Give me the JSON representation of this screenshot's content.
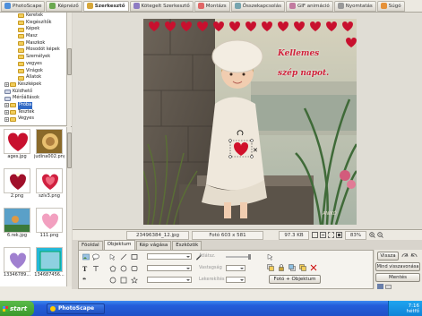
{
  "tabs": [
    {
      "label": "PhotoScape",
      "color": "#4d8fdb"
    },
    {
      "label": "Képnéző",
      "color": "#6aa84f"
    },
    {
      "label": "Szerkesztő",
      "color": "#d7a73a"
    },
    {
      "label": "Kötegelt Szerkesztő",
      "color": "#8e7cc3"
    },
    {
      "label": "Montázs",
      "color": "#e06666"
    },
    {
      "label": "Összekapcsolás",
      "color": "#76a5af"
    },
    {
      "label": "GIF animáció",
      "color": "#c27ba0"
    },
    {
      "label": "Nyomtatás",
      "color": "#999999"
    },
    {
      "label": "Súgó",
      "color": "#e69138"
    }
  ],
  "tree": {
    "items": [
      {
        "label": "Keretek",
        "indent": 2
      },
      {
        "label": "Kiegészítők",
        "indent": 2
      },
      {
        "label": "Képek",
        "indent": 2
      },
      {
        "label": "Masz",
        "indent": 2
      },
      {
        "label": "Maszkok",
        "indent": 2
      },
      {
        "label": "Mosodót képek",
        "indent": 2
      },
      {
        "label": "Személyek",
        "indent": 2
      },
      {
        "label": "vegyes",
        "indent": 2
      },
      {
        "label": "Virágok",
        "indent": 2
      },
      {
        "label": "Állatok",
        "indent": 2
      },
      {
        "label": "Készképek",
        "indent": 1
      },
      {
        "label": "Küldhető",
        "indent": 1
      },
      {
        "label": "Mérőállások",
        "indent": 1
      },
      {
        "label": "Próba",
        "indent": 1,
        "selected": true
      },
      {
        "label": "Tesztek",
        "indent": 1
      },
      {
        "label": "Vegyes",
        "indent": 1
      }
    ]
  },
  "thumbnails": [
    {
      "caption": "ages.jpg"
    },
    {
      "caption": "judina002.png"
    },
    {
      "caption": "2.png"
    },
    {
      "caption": "szív3.png"
    },
    {
      "caption": "6.rek.jpg"
    },
    {
      "caption": "111.png"
    },
    {
      "caption": "13346789..."
    },
    {
      "caption": "134687456..."
    }
  ],
  "photo": {
    "greeting_line1": "Kellemes",
    "greeting_line2": "szép napot.",
    "signature": "ANIKÓ"
  },
  "statusbar": {
    "filename": "23496384_12.jpg",
    "dimensions": "Fotó 603 x 581",
    "filesize": "97.3 KB",
    "zoom": "83%"
  },
  "lower_tabs": [
    "Fõoldal",
    "Objektum",
    "Kép vágása",
    "Eszközök"
  ],
  "tool_panel": {
    "labels": {
      "opacity": "Átlátsz.",
      "thickness": "Vastagság",
      "style": "Lekerekítés"
    },
    "photo_object_button": "Fotó + Objektum"
  },
  "right_panel": {
    "back_button": "Vissza",
    "undo_all_button": "Mind visszavonása",
    "save_button": "Mentés"
  },
  "taskbar": {
    "start_label": "start",
    "app_item": "PhotoScape",
    "time": "7:16",
    "day": "hétfő"
  }
}
